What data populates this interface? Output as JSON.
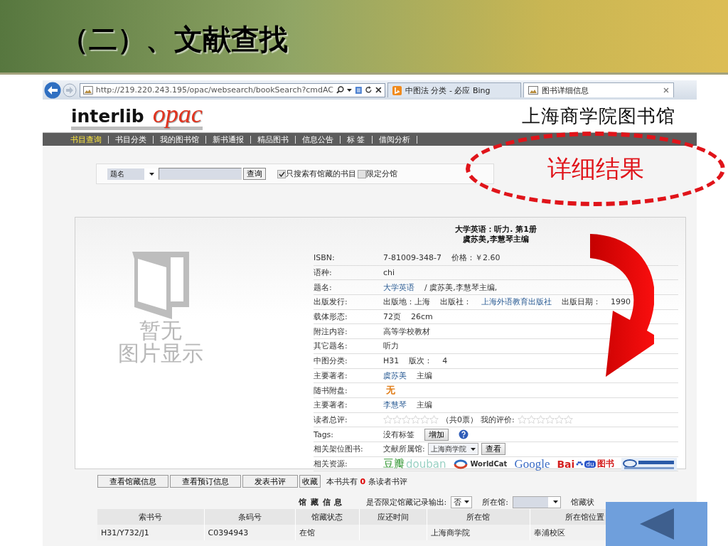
{
  "slide": {
    "title": "（二）、文献查找"
  },
  "browser": {
    "url": "http://219.220.243.195/opac/websearch/bookSearch?cmdAC",
    "tabs": [
      {
        "label": "中图法 分类 - 必应 Bing",
        "selected": false
      },
      {
        "label": "图书详细信息",
        "selected": true
      }
    ]
  },
  "site": {
    "logo_primary": "interlib",
    "logo_secondary": "opac",
    "library_name": "上海商学院图书馆"
  },
  "nav": [
    {
      "label": "书目查询",
      "selected": true
    },
    {
      "label": "书目分类",
      "selected": false
    },
    {
      "label": "我的图书馆",
      "selected": false
    },
    {
      "label": "新书通报",
      "selected": false
    },
    {
      "label": "精品图书",
      "selected": false
    },
    {
      "label": "信息公告",
      "selected": false
    },
    {
      "label": "标 签",
      "selected": false
    },
    {
      "label": "借阅分析",
      "selected": false
    }
  ],
  "search": {
    "field_select": "题名",
    "button": "查询",
    "filters": [
      {
        "label": "只搜索有馆藏的书目",
        "checked": true
      },
      {
        "label": "限定分馆",
        "checked": false
      }
    ]
  },
  "detail": {
    "no_image_lines": [
      "暂无",
      "图片显示"
    ],
    "title": "大学英语：听力. 第1册",
    "responsibility": "虞苏美,李慧琴主编",
    "rows": [
      {
        "label": "ISBN:",
        "kind": "text",
        "parts": [
          {
            "text": "7-81009-348-7",
            "link": false
          },
          {
            "text": "价格：￥2.60",
            "link": false
          }
        ]
      },
      {
        "label": "语种:",
        "kind": "text",
        "parts": [
          {
            "text": "chi",
            "link": false
          }
        ]
      },
      {
        "label": "题名:",
        "kind": "text",
        "parts": [
          {
            "text": "大学英语",
            "link": true
          },
          {
            "text": "/ 虞苏美,李慧琴主编,",
            "link": false
          }
        ]
      },
      {
        "label": "出版发行:",
        "kind": "text",
        "parts": [
          {
            "text": "出版地：上海",
            "link": false
          },
          {
            "text": "出版社：",
            "link": false
          },
          {
            "text": "上海外语教育出版社",
            "link": true
          },
          {
            "text": "出版日期：",
            "link": false
          },
          {
            "text": "1990",
            "link": false
          }
        ]
      },
      {
        "label": "载体形态:",
        "kind": "text",
        "parts": [
          {
            "text": "72页",
            "link": false
          },
          {
            "text": "26cm",
            "link": false
          }
        ]
      },
      {
        "label": "附注内容:",
        "kind": "text",
        "parts": [
          {
            "text": "高等学校教材",
            "link": false
          }
        ]
      },
      {
        "label": "其它题名:",
        "kind": "text",
        "parts": [
          {
            "text": "听力",
            "link": false
          }
        ]
      },
      {
        "label": "中图分类:",
        "kind": "text",
        "parts": [
          {
            "text": "H31",
            "link": false
          },
          {
            "text": "版次：",
            "link": false
          },
          {
            "text": "4",
            "link": false
          }
        ]
      },
      {
        "label": "主要著者:",
        "kind": "text",
        "parts": [
          {
            "text": "虞苏美",
            "link": true
          },
          {
            "text": "主编",
            "link": false
          }
        ]
      },
      {
        "label": "随书附盘:",
        "kind": "disc",
        "text": "无"
      },
      {
        "label": "主要著者:",
        "kind": "text",
        "parts": [
          {
            "text": "李慧琴",
            "link": true
          },
          {
            "text": "主编",
            "link": false
          }
        ]
      },
      {
        "label": "读者总评:",
        "kind": "rating",
        "overall": {
          "stars": 0
        },
        "votes": "（共0票）",
        "my_label": "我的评价:",
        "mine": {
          "stars": 0
        }
      },
      {
        "label": "Tags:",
        "kind": "tags",
        "text": "没有标签",
        "button": "增加"
      },
      {
        "label": "相关架位图书:",
        "kind": "shelf",
        "text": "文献所属馆:",
        "select": "上海商学院",
        "button": "查看"
      },
      {
        "label": "相关资源:",
        "kind": "resources",
        "items": [
          {
            "kind": "douban",
            "texts": [
              "豆瓣",
              "douban"
            ]
          },
          {
            "kind": "worldcat",
            "texts": [
              "WorldCat"
            ]
          },
          {
            "kind": "google",
            "texts": [
              "Google"
            ]
          },
          {
            "kind": "baidu",
            "texts": [
              "Bai",
              "du",
              "图书"
            ]
          },
          {
            "kind": "cnki"
          }
        ]
      }
    ]
  },
  "actions": {
    "buttons": [
      "查看馆藏信息",
      "查看预订信息",
      "发表书评",
      "收藏"
    ],
    "review_note": "本书共有 **0** 条读者书评"
  },
  "holdings": {
    "heading": "馆 藏 信 息",
    "limit_label": "是否限定馆藏记录输出:",
    "limit_value": "否",
    "library_label": "所在馆:",
    "status_label": "馆藏状",
    "columns": [
      "索书号",
      "条码号",
      "馆藏状态",
      "应还时间",
      "所在馆",
      "所在馆位置"
    ],
    "rows": [
      {
        "cells": [
          {
            "kind": "text",
            "text": "H31/Y732/J1"
          },
          {
            "kind": "text",
            "text": "C0394943"
          },
          {
            "kind": "text",
            "text": "在馆"
          },
          {
            "kind": "blank"
          },
          {
            "kind": "text",
            "text": "上海商学院"
          },
          {
            "kind": "text",
            "text": "奉浦校区"
          }
        ]
      }
    ]
  },
  "callout": {
    "text": "详细结果"
  }
}
